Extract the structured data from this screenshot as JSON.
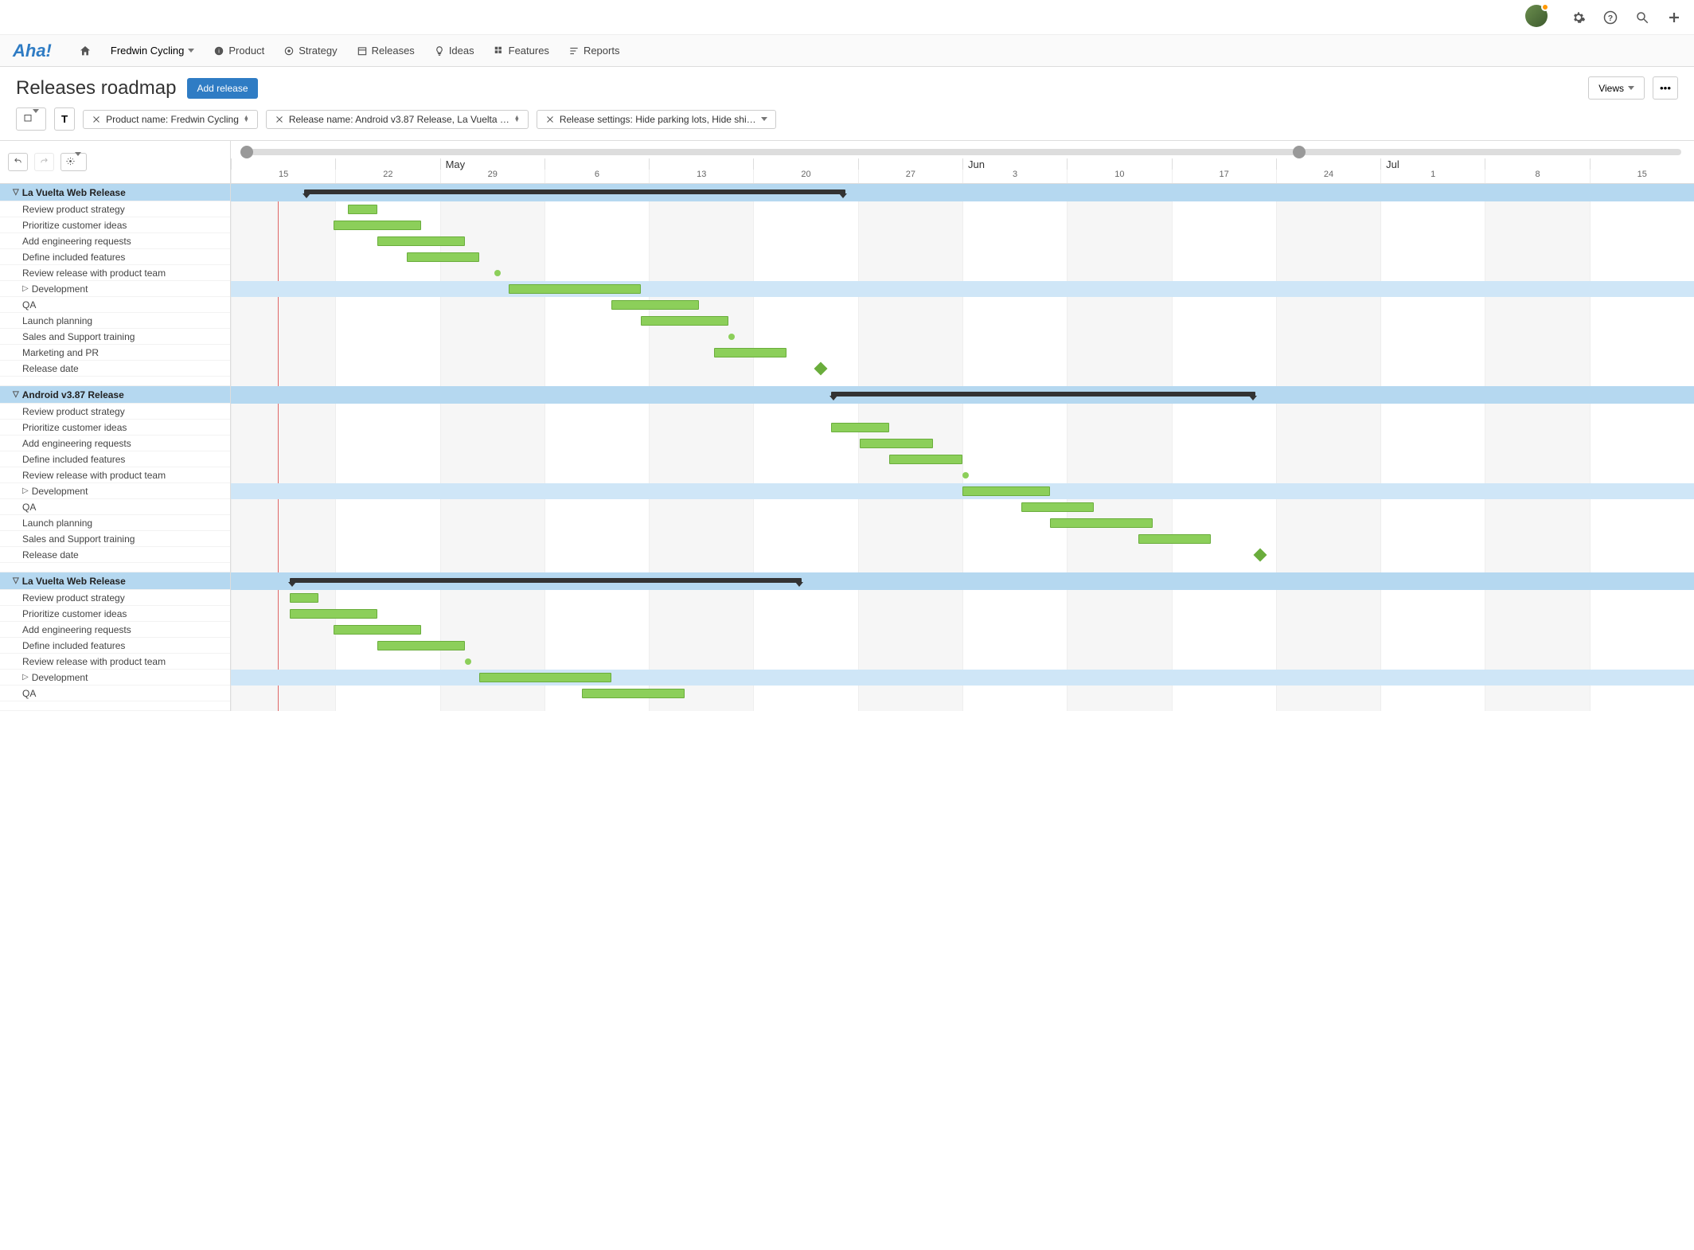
{
  "logo": "Aha!",
  "product_selector": "Fredwin Cycling",
  "nav": {
    "product": "Product",
    "strategy": "Strategy",
    "releases": "Releases",
    "ideas": "Ideas",
    "features": "Features",
    "reports": "Reports"
  },
  "page_title": "Releases roadmap",
  "add_release_btn": "Add release",
  "views_btn": "Views",
  "filters": {
    "product": "Product name: Fredwin Cycling",
    "release": "Release name: Android v3.87 Release, La Vuelta …",
    "settings": "Release settings: Hide parking lots, Hide shi…"
  },
  "timeline": {
    "months": [
      "May",
      "Jun",
      "Jul"
    ],
    "days": [
      "15",
      "22",
      "29",
      "6",
      "13",
      "20",
      "27",
      "3",
      "10",
      "17",
      "24",
      "1",
      "8",
      "15"
    ]
  },
  "releases": [
    {
      "name": "La Vuelta Web Release",
      "summary_bar": {
        "start": 5,
        "end": 42
      },
      "tasks": [
        {
          "name": "Review product strategy",
          "bar": {
            "start": 8,
            "end": 10
          }
        },
        {
          "name": "Prioritize customer ideas",
          "bar": {
            "start": 7,
            "end": 13
          }
        },
        {
          "name": "Add engineering requests",
          "bar": {
            "start": 10,
            "end": 16
          }
        },
        {
          "name": "Define included features",
          "bar": {
            "start": 12,
            "end": 17
          }
        },
        {
          "name": "Review release with product team",
          "dot": 18
        },
        {
          "name": "Development",
          "bar": {
            "start": 19,
            "end": 28
          },
          "expandable": true
        },
        {
          "name": "QA",
          "bar": {
            "start": 26,
            "end": 32
          }
        },
        {
          "name": "Launch planning",
          "bar": {
            "start": 28,
            "end": 34
          }
        },
        {
          "name": "Sales and Support training",
          "dot": 34
        },
        {
          "name": "Marketing and PR",
          "bar": {
            "start": 33,
            "end": 38
          }
        },
        {
          "name": "Release date",
          "diamond": 40
        }
      ]
    },
    {
      "name": "Android v3.87 Release",
      "summary_bar": {
        "start": 41,
        "end": 70
      },
      "tasks": [
        {
          "name": "Review product strategy"
        },
        {
          "name": "Prioritize customer ideas",
          "bar": {
            "start": 41,
            "end": 45
          }
        },
        {
          "name": "Add engineering requests",
          "bar": {
            "start": 43,
            "end": 48
          }
        },
        {
          "name": "Define included features",
          "bar": {
            "start": 45,
            "end": 50
          }
        },
        {
          "name": "Review release with product team",
          "dot": 50
        },
        {
          "name": "Development",
          "bar": {
            "start": 50,
            "end": 56
          },
          "expandable": true
        },
        {
          "name": "QA",
          "bar": {
            "start": 54,
            "end": 59
          }
        },
        {
          "name": "Launch planning",
          "bar": {
            "start": 56,
            "end": 63
          }
        },
        {
          "name": "Sales and Support training",
          "bar": {
            "start": 62,
            "end": 67
          }
        },
        {
          "name": "Release date",
          "diamond": 70
        }
      ]
    },
    {
      "name": "La Vuelta Web Release",
      "summary_bar": {
        "start": 4,
        "end": 39
      },
      "tasks": [
        {
          "name": "Review product strategy",
          "bar": {
            "start": 4,
            "end": 6
          }
        },
        {
          "name": "Prioritize customer ideas",
          "bar": {
            "start": 4,
            "end": 10
          }
        },
        {
          "name": "Add engineering requests",
          "bar": {
            "start": 7,
            "end": 13
          }
        },
        {
          "name": "Define included features",
          "bar": {
            "start": 10,
            "end": 16
          }
        },
        {
          "name": "Review release with product team",
          "dot": 16
        },
        {
          "name": "Development",
          "bar": {
            "start": 17,
            "end": 26
          },
          "expandable": true
        },
        {
          "name": "QA",
          "bar": {
            "start": 24,
            "end": 31
          }
        }
      ]
    }
  ]
}
